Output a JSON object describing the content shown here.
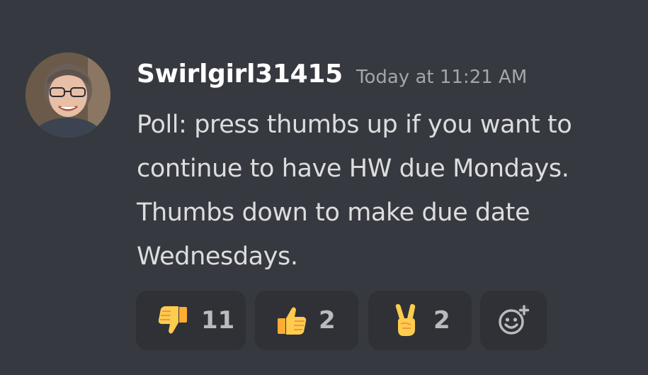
{
  "message": {
    "author": "Swirlgirl31415",
    "timestamp": "Today at 11:21 AM",
    "lines": [
      "Poll: press thumbs up if you want to",
      "continue to have HW due Mondays.",
      "Thumbs down to make due date",
      "Wednesdays."
    ]
  },
  "reactions": [
    {
      "emoji": "thumbs-down",
      "count": "11"
    },
    {
      "emoji": "thumbs-up",
      "count": "2"
    },
    {
      "emoji": "victory-hand",
      "count": "2"
    }
  ],
  "add_reaction": {
    "icon": "add-reaction-icon"
  },
  "colors": {
    "background": "#36393f",
    "reaction_background": "#2f3136",
    "username": "#ffffff",
    "message_text": "#dcddde",
    "timestamp": "#a3a6aa",
    "emoji_yellow": "#ffcc4d"
  }
}
